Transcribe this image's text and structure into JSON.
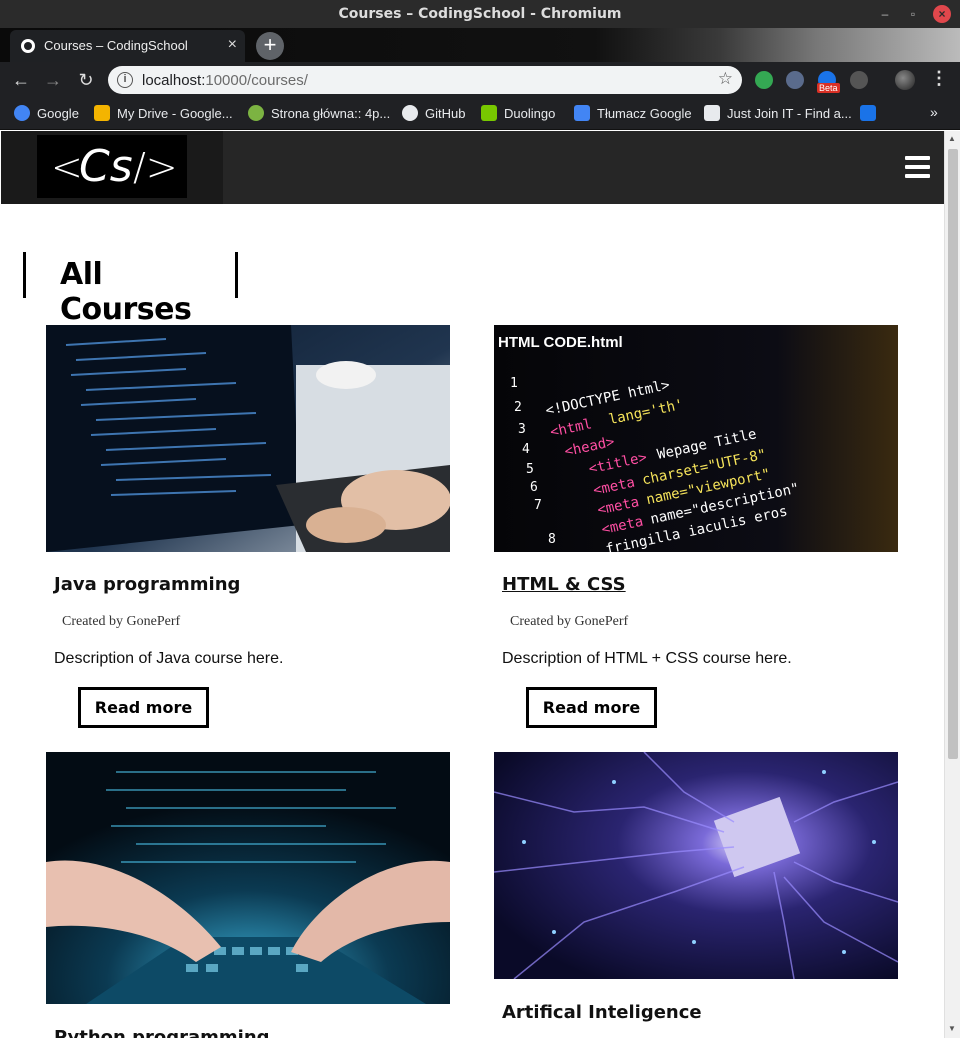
{
  "window": {
    "title": "Courses – CodingSchool - Chromium"
  },
  "tab": {
    "label": "Courses – CodingSchool",
    "close": "×",
    "new_tab": "+"
  },
  "toolbar": {
    "back": "←",
    "forward": "→",
    "reload": "↻",
    "url_host": "localhost:",
    "url_path": "10000/courses/",
    "star": "☆",
    "info": "i",
    "ext_beta": "Beta",
    "menu": "⋮"
  },
  "bookmarks": [
    {
      "label": "Google",
      "color": "#4285f4"
    },
    {
      "label": "My Drive - Google...",
      "color": "#f4b400"
    },
    {
      "label": "Strona główna:: 4p...",
      "color": "#7cb342"
    },
    {
      "label": "GitHub",
      "color": "#e8eaed"
    },
    {
      "label": "Duolingo",
      "color": "#78c800"
    },
    {
      "label": "Tłumacz Google",
      "color": "#4285f4"
    },
    {
      "label": "Just Join IT - Find a...",
      "color": "#e8eaed"
    }
  ],
  "bookmarks_more": "»",
  "site": {
    "logo": {
      "lt": "<",
      "cs": "Cs",
      "gt": "/>"
    },
    "heading": "All Courses",
    "courses": [
      {
        "title": "Java programming",
        "author": "Created by GonePerf",
        "description": "Description of Java course here.",
        "button": "Read more",
        "image": "laptop-code-photo"
      },
      {
        "title": "HTML & CSS",
        "author": "Created by GonePerf",
        "description": "Description of HTML + CSS course here.",
        "button": "Read more",
        "image": "html-code-photo"
      },
      {
        "title": "Python programming",
        "image": "keyboard-hands-photo"
      },
      {
        "title": "Artifical Inteligence",
        "image": "circuit-board-photo"
      }
    ]
  },
  "colors": {
    "header_bg": "#262626",
    "chrome_bg": "#202124"
  }
}
